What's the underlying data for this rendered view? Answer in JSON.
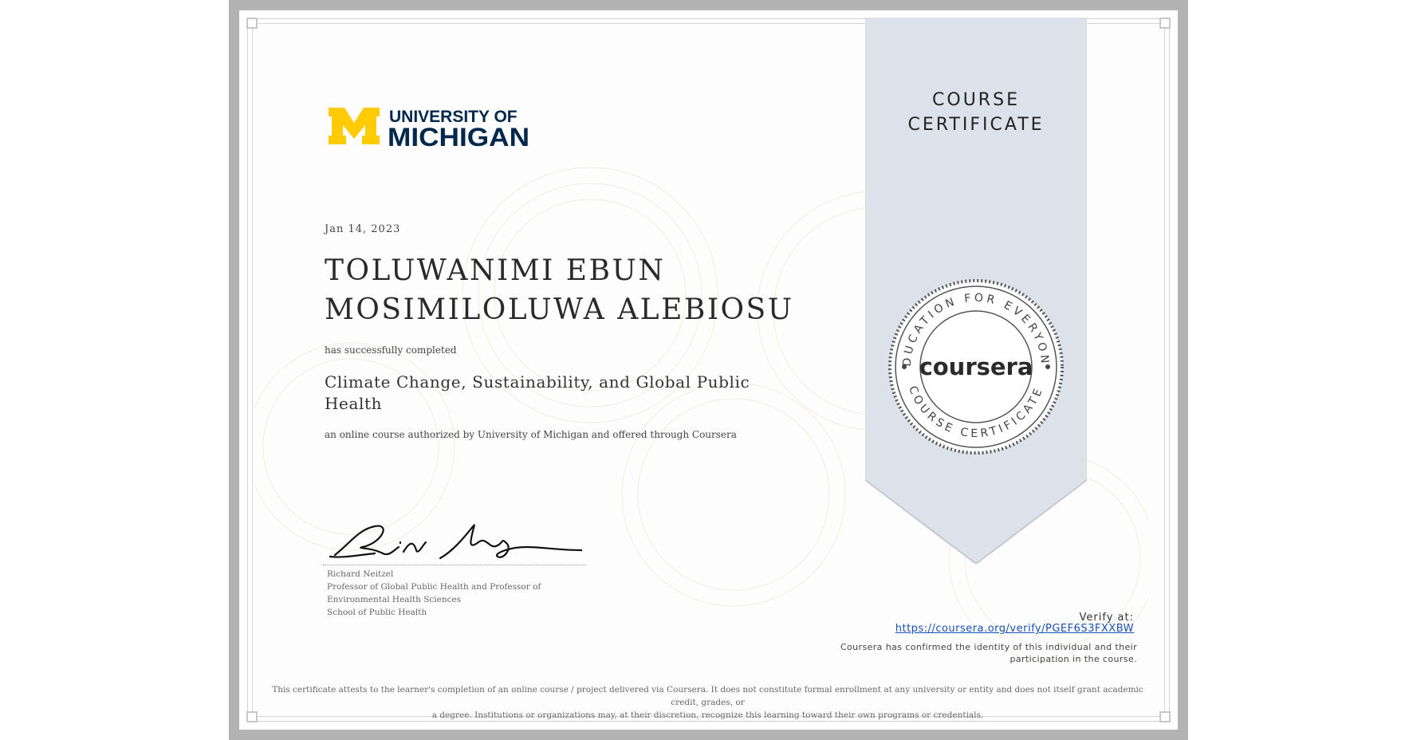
{
  "certificate": {
    "issuer_logo": {
      "line1": "UNIVERSITY OF",
      "line2": "MICHIGAN",
      "mark": "M",
      "mark_color": "#FFCB05",
      "text_color": "#00274C"
    },
    "ribbon_title_line1": "COURSE",
    "ribbon_title_line2": "CERTIFICATE",
    "date": "Jan 14, 2023",
    "recipient_line1": "TOLUWANIMI EBUN",
    "recipient_line2": "MOSIMILOLUWA ALEBIOSU",
    "completed_text": "has successfully completed",
    "course_title_line1": "Climate Change, Sustainability, and Global Public",
    "course_title_line2": "Health",
    "authorized_text": "an online course authorized by University of Michigan and offered through Coursera",
    "signer": {
      "name": "Richard Neitzel",
      "title_line1": "Professor of Global Public Health and Professor of",
      "title_line2": "Environmental Health Sciences",
      "title_line3": "School of Public Health"
    },
    "seal": {
      "brand": "coursera",
      "ring_text_top": "EDUCATION FOR EVERYONE",
      "ring_text_bottom": "COURSE CERTIFICATE"
    },
    "verify_label": "Verify at:",
    "verify_url": "https://coursera.org/verify/PGEF6S3FXXBW",
    "identity_line1": "Coursera has confirmed the identity of this individual and their",
    "identity_line2": "participation in the course.",
    "disclaimer_line1": "This certificate attests to the learner's completion of an online course / project delivered via Coursera. It does not constitute formal enrollment at any university or entity and does not itself grant academic credit, grades, or",
    "disclaimer_line2": "a degree. Institutions or organizations may, at their discretion, recognize this learning toward their own programs or credentials."
  },
  "colors": {
    "ribbon": "#dde2ea",
    "frame": "#b3b3b3",
    "link": "#1a4fb5"
  }
}
